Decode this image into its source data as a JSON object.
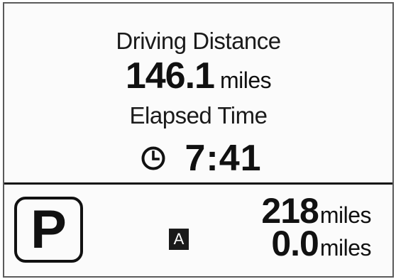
{
  "cluster": {
    "driving_distance_label": "Driving Distance",
    "driving_distance_value": "146.1",
    "driving_distance_unit": "miles",
    "elapsed_time_label": "Elapsed Time",
    "elapsed_time_value": "7:41",
    "clock_icon": "clock-icon"
  },
  "bottom": {
    "gear": "P",
    "trip_badge": "A",
    "odometer_value": "218",
    "odometer_unit": "miles",
    "trip_value": "0.0",
    "trip_unit": "miles"
  },
  "colors": {
    "text": "#111111",
    "background": "#fbfbfb",
    "badge_bg": "#1a1a1a",
    "badge_text": "#ffffff"
  }
}
